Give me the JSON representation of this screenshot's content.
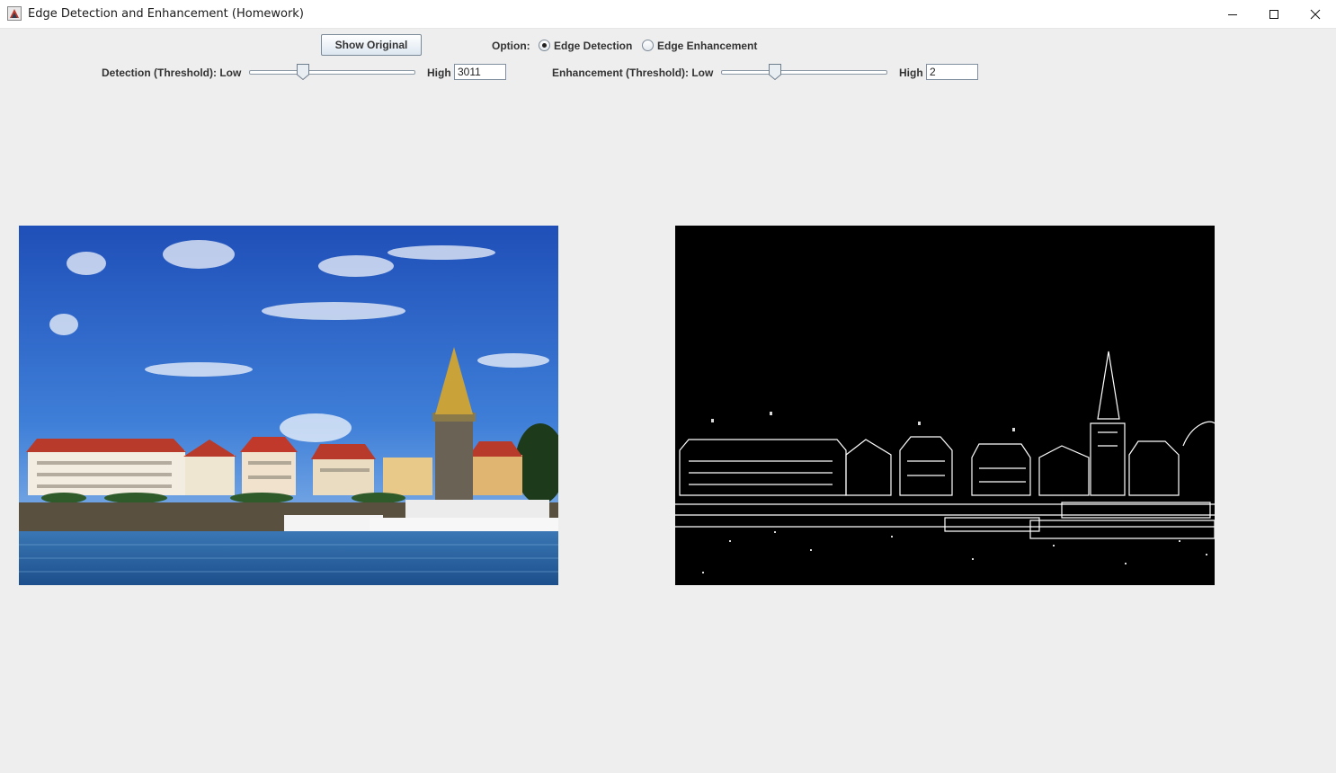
{
  "window": {
    "title": "Edge Detection and Enhancement (Homework)"
  },
  "toolbar": {
    "show_original_label": "Show Original",
    "option_label": "Option:",
    "options": [
      {
        "label": "Edge Detection",
        "selected": true
      },
      {
        "label": "Edge Enhancement",
        "selected": false
      }
    ]
  },
  "detection": {
    "label": "Detection (Threshold): Low",
    "high_label": "High",
    "high_value": "3011",
    "slider_fraction": 0.31
  },
  "enhancement": {
    "label": "Enhancement (Threshold): Low",
    "high_label": "High",
    "high_value": "2",
    "slider_fraction": 0.31
  },
  "images": {
    "original": "original-harbor-photo",
    "result": "edge-detection-result"
  }
}
